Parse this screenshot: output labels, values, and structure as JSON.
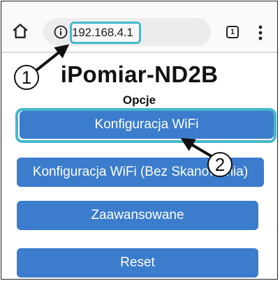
{
  "browser": {
    "url": "192.168.4.1",
    "tab_count": "1",
    "icons": [
      "home-icon",
      "info-icon",
      "tabs-icon",
      "menu-icon"
    ]
  },
  "page": {
    "title": "iPomiar-ND2B",
    "subtitle": "Opcje"
  },
  "buttons": {
    "wifi_config": "Konfiguracja WiFi",
    "wifi_config_noscan": "Konfiguracja WiFi (Bez Skanowania)",
    "advanced": "Zaawansowane",
    "reset": "Reset"
  },
  "annotations": {
    "callout_1": "1",
    "callout_2": "2"
  },
  "colors": {
    "button_bg": "#3b7ccd",
    "highlight": "#45b8c9"
  }
}
